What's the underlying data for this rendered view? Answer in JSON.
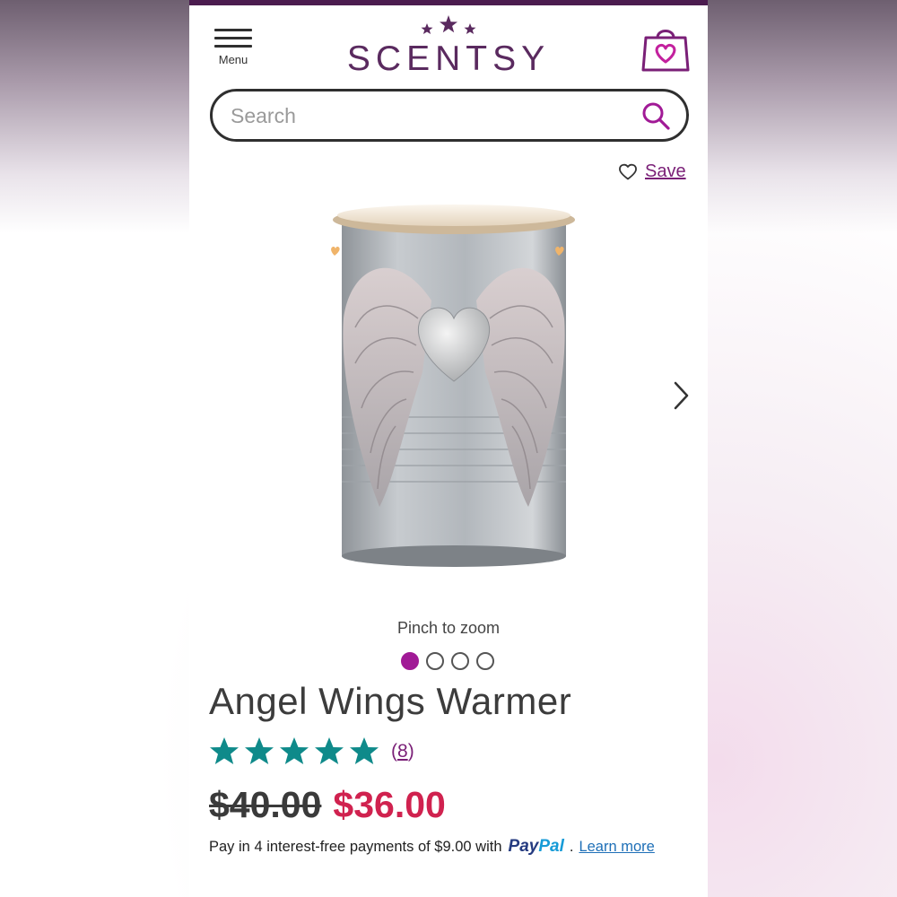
{
  "header": {
    "menu_label": "Menu",
    "brand": "SCENTSY",
    "brand_color": "#5a2a5f",
    "top_bar_color": "#4b1c4f",
    "icons": [
      "menu-icon",
      "stars-logo-icon",
      "shopping-bag-heart-icon"
    ]
  },
  "search": {
    "placeholder": "Search",
    "value": "",
    "icon": "search-icon"
  },
  "save": {
    "label": "Save",
    "icon": "heart-outline-icon"
  },
  "gallery": {
    "pinch_text": "Pinch to zoom",
    "slide_count": 4,
    "active_slide": 1,
    "next_icon": "chevron-right-icon"
  },
  "product": {
    "title": "Angel Wings Warmer",
    "rating_stars": 5,
    "rating_count_open": "(",
    "rating_count": "8",
    "rating_count_close": ")",
    "star_color": "#0f8a8a",
    "old_price": "$40.00",
    "new_price": "$36.00",
    "sale_color": "#d0224f"
  },
  "payment": {
    "text": "Pay in 4 interest-free payments of $9.00 with",
    "paypal_part1": "Pay",
    "paypal_part2": "Pal",
    "separator": ".",
    "learn_more": "Learn more"
  }
}
